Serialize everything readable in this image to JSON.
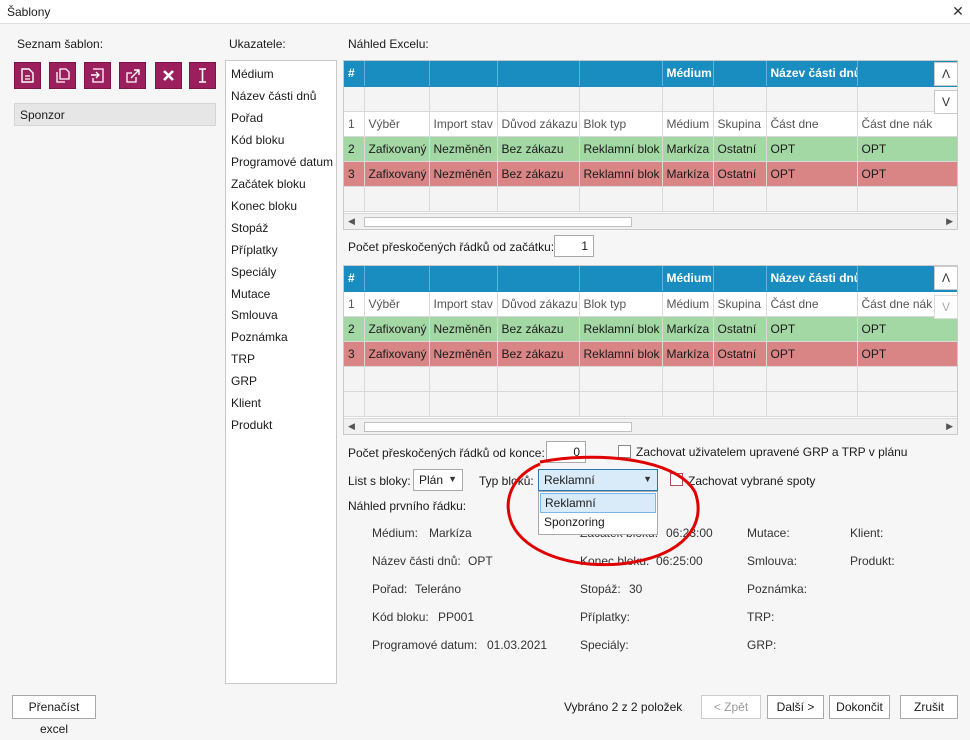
{
  "window": {
    "title": "Šablony",
    "close_icon": "close-icon"
  },
  "left": {
    "heading": "Seznam šablon:",
    "toolbar_icons": [
      "new-document-icon",
      "copy-document-icon",
      "import-icon",
      "export-icon",
      "delete-icon",
      "rename-icon"
    ],
    "templates": [
      "Sponzor"
    ]
  },
  "indicators": {
    "heading": "Ukazatele:",
    "items": [
      "Médium",
      "Název části dnů",
      "Pořad",
      "Kód bloku",
      "Programové datum",
      "Začátek bloku",
      "Konec bloku",
      "Stopáž",
      "Příplatky",
      "Speciály",
      "Mutace",
      "Smlouva",
      "Poznámka",
      "TRP",
      "GRP",
      "Klient",
      "Produkt"
    ]
  },
  "preview": {
    "heading": "Náhled Excelu:",
    "grid1": {
      "header": [
        "#",
        "",
        "",
        "",
        "",
        "Médium",
        "",
        "Název části dnů",
        ""
      ],
      "colnames": [
        "1",
        "Výběr",
        "Import stav",
        "Důvod zákazu",
        "Blok typ",
        "Médium",
        "Skupina",
        "Část dne",
        "Část dne nák"
      ],
      "rows": [
        {
          "style": "green",
          "cells": [
            "2",
            "Zafixovaný",
            "Nezměněn",
            "Bez zákazu",
            "Reklamní blok",
            "Markíza",
            "Ostatní",
            "OPT",
            "OPT"
          ]
        },
        {
          "style": "red",
          "cells": [
            "3",
            "Zafixovaný",
            "Nezměněn",
            "Bez zákazu",
            "Reklamní blok",
            "Markíza",
            "Ostatní",
            "OPT",
            "OPT"
          ]
        }
      ]
    },
    "skip_start_label": "Počet přeskočených řádků od začátku:",
    "skip_start_value": "1",
    "grid2": {
      "header": [
        "#",
        "",
        "",
        "",
        "",
        "Médium",
        "",
        "Název části dnů",
        ""
      ],
      "colnames": [
        "1",
        "Výběr",
        "Import stav",
        "Důvod zákazu",
        "Blok typ",
        "Médium",
        "Skupina",
        "Část dne",
        "Část dne nák"
      ],
      "rows": [
        {
          "style": "green",
          "cells": [
            "2",
            "Zafixovaný",
            "Nezměněn",
            "Bez zákazu",
            "Reklamní blok",
            "Markíza",
            "Ostatní",
            "OPT",
            "OPT"
          ]
        },
        {
          "style": "red",
          "cells": [
            "3",
            "Zafixovaný",
            "Nezměněn",
            "Bez zákazu",
            "Reklamní blok",
            "Markíza",
            "Ostatní",
            "OPT",
            "OPT"
          ]
        }
      ]
    },
    "up_label": "Λ",
    "down_label": "V",
    "skip_end_label": "Počet přeskočených řádků od konce:",
    "skip_end_value": "0",
    "keep_grp_label": "Zachovat uživatelem upravené GRP a TRP v plánu",
    "sheet_label": "List s bloky:",
    "sheet_value": "Plán",
    "block_type_label": "Typ bloků:",
    "block_type_value": "Reklamní",
    "block_type_options": [
      "Reklamní",
      "Sponzoring"
    ],
    "keep_spots_label": "Zachovat vybrané spoty",
    "first_row_heading": "Náhled prvního řádku:",
    "first_row": {
      "medium_label": "Médium:",
      "medium_value": "Markíza",
      "part_label": "Název části dnů:",
      "part_value": "OPT",
      "show_label": "Pořad:",
      "show_value": "Teleráno",
      "code_label": "Kód bloku:",
      "code_value": "PP001",
      "date_label": "Programové datum:",
      "date_value": "01.03.2021",
      "start_label": "Začátek bloku:",
      "start_value": "06:23:00",
      "end_label": "Konec bloku:",
      "end_value": "06:25:00",
      "length_label": "Stopáž:",
      "length_value": "30",
      "surcharge_label": "Příplatky:",
      "special_label": "Speciály:",
      "mutation_label": "Mutace:",
      "contract_label": "Smlouva:",
      "note_label": "Poznámka:",
      "trp_label": "TRP:",
      "grp_label": "GRP:",
      "client_label": "Klient:",
      "product_label": "Produkt:"
    }
  },
  "footer": {
    "reload_label": "Přenačíst excel",
    "selected_text": "Vybráno 2 z 2 položek",
    "back_label": "< Zpět",
    "next_label": "Další >",
    "finish_label": "Dokončit",
    "cancel_label": "Zrušit"
  },
  "colors": {
    "accent": "#9c1f5d",
    "header_blue": "#1a8dc0",
    "row_green": "#a3d7a3",
    "row_red": "#d98585",
    "annotation_red": "#e00000"
  }
}
